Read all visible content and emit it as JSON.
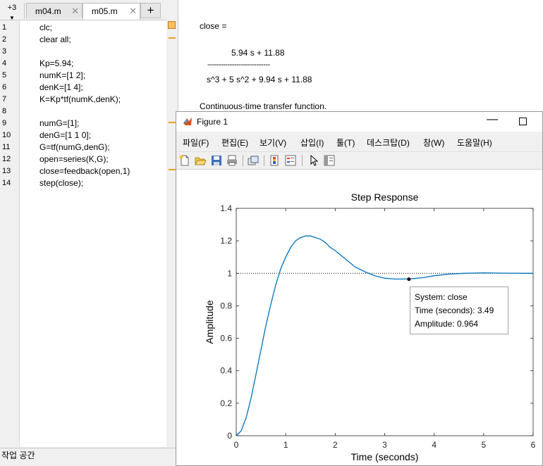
{
  "editor": {
    "tabs_more": "+3",
    "tabs": [
      {
        "label": "m04.m",
        "close": "✕"
      },
      {
        "label": "m05.m",
        "close": "✕"
      }
    ],
    "add_tab": "+",
    "lines": [
      {
        "n": "1",
        "code": "clc;"
      },
      {
        "n": "2",
        "code": "clear all;"
      },
      {
        "n": "3",
        "code": ""
      },
      {
        "n": "4",
        "code": "Kp=5.94;"
      },
      {
        "n": "5",
        "code": "numK=[1 2];"
      },
      {
        "n": "6",
        "code": "denK=[1 4];"
      },
      {
        "n": "7",
        "code": "K=Kp*tf(numK,denK);"
      },
      {
        "n": "8",
        "code": ""
      },
      {
        "n": "9",
        "code": "numG=[1];"
      },
      {
        "n": "10",
        "code": "denG=[1 1 0];"
      },
      {
        "n": "11",
        "code": "G=tf(numG,denG);"
      },
      {
        "n": "12",
        "code": "open=series(K,G);"
      },
      {
        "n": "13",
        "code": "close=feedback(open,1)"
      },
      {
        "n": "14",
        "code": "step(close);"
      }
    ],
    "workspace_label": "작업 공간"
  },
  "command_window": {
    "var_line": "close =",
    "numerator": "5.94 s + 11.88",
    "fraction_bar": "----------------------------",
    "denominator": "s^3 + 5 s^2 + 9.94 s + 11.88",
    "note": "Continuous-time transfer function."
  },
  "figure": {
    "title": "Figure 1",
    "minimize": "—",
    "menus": [
      "파일(F)",
      "편집(E)",
      "보기(V)",
      "삽입(I)",
      "툴(T)",
      "데스크탑(D)",
      "창(W)",
      "도움말(H)"
    ],
    "toolbar_icons": [
      "new-figure-icon",
      "open-file-icon",
      "save-icon",
      "print-icon",
      "link-plot-icon",
      "colorbar-icon",
      "legend-icon",
      "pointer-icon",
      "property-inspector-icon"
    ]
  },
  "chart_data": {
    "type": "line",
    "title": "Step Response",
    "xlabel": "Time (seconds)",
    "ylabel": "Amplitude",
    "xlim": [
      0,
      6
    ],
    "ylim": [
      0,
      1.4
    ],
    "xticks": [
      "0",
      "1",
      "2",
      "3",
      "4",
      "5",
      "6"
    ],
    "yticks": [
      "0",
      "0.2",
      "0.4",
      "0.6",
      "0.8",
      "1",
      "1.2",
      "1.4"
    ],
    "reference_line": 1,
    "line_color": "#0072bd",
    "series": [
      {
        "x": [
          0,
          0.1,
          0.2,
          0.3,
          0.4,
          0.5,
          0.6,
          0.7,
          0.8,
          0.9,
          1.0,
          1.1,
          1.2,
          1.3,
          1.4,
          1.5,
          1.6,
          1.7,
          1.8,
          1.9,
          2.0,
          2.2,
          2.4,
          2.6,
          2.8,
          3.0,
          3.2,
          3.4,
          3.6,
          3.8,
          4.0,
          4.3,
          4.6,
          5.0,
          5.5,
          6.0
        ],
        "y": [
          0,
          0.03,
          0.11,
          0.23,
          0.38,
          0.53,
          0.68,
          0.81,
          0.93,
          1.03,
          1.1,
          1.16,
          1.2,
          1.22,
          1.23,
          1.23,
          1.22,
          1.21,
          1.19,
          1.16,
          1.14,
          1.09,
          1.04,
          1.01,
          0.985,
          0.97,
          0.965,
          0.965,
          0.968,
          0.975,
          0.985,
          0.995,
          1.0,
          1.003,
          1.001,
          1.0
        ]
      }
    ],
    "datatip": {
      "x": 3.49,
      "y": 0.964,
      "lines": [
        "System: close",
        "Time (seconds): 3.49",
        "Amplitude: 0.964"
      ]
    }
  }
}
